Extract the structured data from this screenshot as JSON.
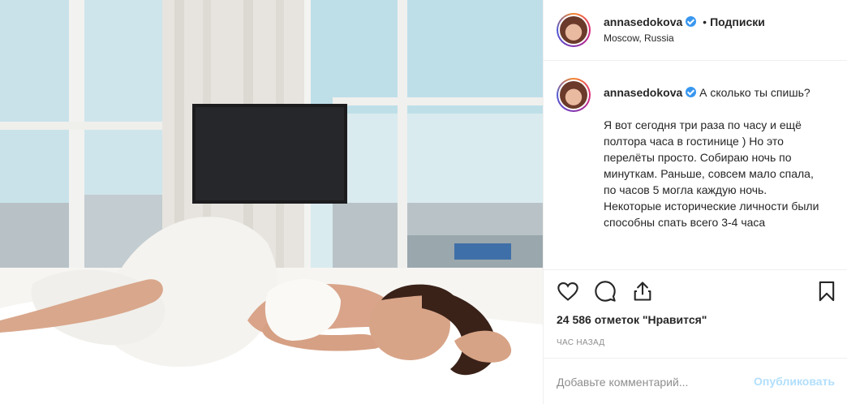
{
  "post": {
    "author": {
      "username": "annasedokova",
      "verified": true,
      "location": "Moscow, Russia"
    },
    "header": {
      "separator": "•",
      "follow_label": "Подписки"
    },
    "caption": {
      "first_line": "А сколько ты спишь?",
      "body_lines": [
        "Я вот сегодня три раза по часу и ещё полтора часа в гостинице ) Но это перелёты просто. Собираю ночь по минуткам. Раньше, совсем мало спала, по часов 5 могла каждую ночь.",
        "Некоторые исторические личности были способны спать всего 3-4 часа"
      ]
    },
    "actions": {
      "like_icon": "heart-icon",
      "comment_icon": "speech-bubble-icon",
      "share_icon": "share-icon",
      "save_icon": "bookmark-icon"
    },
    "likes_text": "24 586 отметок \"Нравится\"",
    "time_text": "час назад",
    "comment": {
      "placeholder": "Добавьте комментарий...",
      "publish_label": "Опубликовать"
    },
    "colors": {
      "verified_badge": "#3897f0",
      "publish_disabled": "#b2dffc",
      "muted_text": "#8e8e8e",
      "divider": "#efefef"
    }
  }
}
